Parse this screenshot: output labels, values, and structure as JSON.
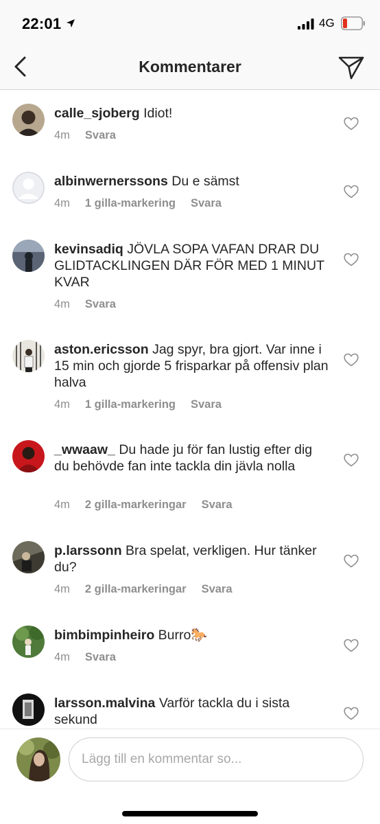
{
  "status_bar": {
    "time": "22:01",
    "network": "4G",
    "location_icon": "location-arrow-icon",
    "signal_icon": "cellular-signal-icon",
    "battery_icon": "battery-low-icon",
    "battery_color": "#e0301e"
  },
  "nav": {
    "title": "Kommentarer",
    "back_icon": "chevron-left-icon",
    "send_icon": "paper-plane-icon"
  },
  "comments": [
    {
      "username": "calle_sjoberg",
      "text": "Idiot!",
      "time": "4m",
      "likes": "",
      "reply": "Svara"
    },
    {
      "username": "albinwernerssons",
      "text": "Du e sämst",
      "time": "4m",
      "likes": "1 gilla-markering",
      "reply": "Svara"
    },
    {
      "username": "kevinsadiq",
      "text": "JÖVLA SOPA VAFAN DRAR DU GLIDTACKLINGEN DÄR FÖR MED 1 MINUT KVAR",
      "time": "4m",
      "likes": "",
      "reply": "Svara"
    },
    {
      "username": "aston.ericsson",
      "text": "Jag spyr, bra gjort. Var inne i 15 min och gjorde 5 frisparkar på offensiv plan halva",
      "time": "4m",
      "likes": "1 gilla-markering",
      "reply": "Svara"
    },
    {
      "username": "_wwaaw_",
      "text": "Du hade ju för fan lustig efter dig du behövde fan inte tackla din jävla nolla",
      "time": "4m",
      "likes": "2 gilla-markeringar",
      "reply": "Svara"
    },
    {
      "username": "p.larssonn",
      "text": "Bra spelat, verkligen. Hur tänker du?",
      "time": "4m",
      "likes": "2 gilla-markeringar",
      "reply": "Svara"
    },
    {
      "username": "bimbimpinheiro",
      "text": "Burro🐎",
      "time": "4m",
      "likes": "",
      "reply": "Svara"
    },
    {
      "username": "larsson.malvina",
      "text": "Varför tackla du i sista sekund",
      "time": "",
      "likes": "",
      "reply": ""
    }
  ],
  "comment_box": {
    "placeholder": "Lägg till en kommentar so..."
  },
  "colors": {
    "text": "#262626",
    "meta": "#8e8e8e",
    "bar_background": "#f9f9f9"
  }
}
